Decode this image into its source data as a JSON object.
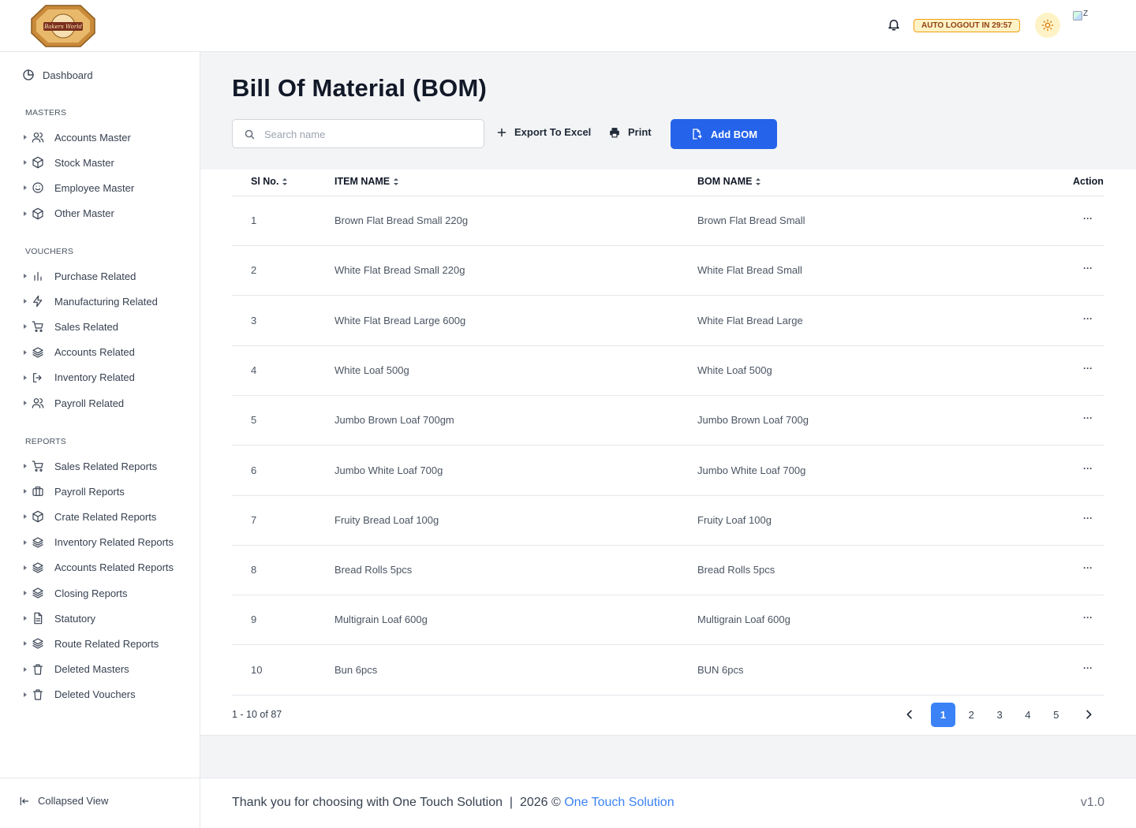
{
  "header": {
    "logo_text": "Bakers World",
    "auto_logout": "AUTO LOGOUT IN 29:57",
    "avatar_alt": "Z"
  },
  "sidebar": {
    "dashboard": "Dashboard",
    "sections": [
      {
        "title": "MASTERS",
        "items": [
          {
            "label": "Accounts Master",
            "icon": "user-icon"
          },
          {
            "label": "Stock Master",
            "icon": "cube-icon"
          },
          {
            "label": "Employee Master",
            "icon": "smile-icon"
          },
          {
            "label": "Other Master",
            "icon": "cube-icon"
          }
        ]
      },
      {
        "title": "VOUCHERS",
        "items": [
          {
            "label": "Purchase Related",
            "icon": "bar-chart-icon"
          },
          {
            "label": "Manufacturing Related",
            "icon": "bolt-icon"
          },
          {
            "label": "Sales Related",
            "icon": "cart-icon"
          },
          {
            "label": "Accounts Related",
            "icon": "layers-icon"
          },
          {
            "label": "Inventory Related",
            "icon": "logout-icon"
          },
          {
            "label": "Payroll Related",
            "icon": "user-icon"
          }
        ]
      },
      {
        "title": "REPORTS",
        "items": [
          {
            "label": "Sales Related Reports",
            "icon": "cart-icon"
          },
          {
            "label": "Payroll Reports",
            "icon": "briefcase-icon"
          },
          {
            "label": "Crate Related Reports",
            "icon": "cube-icon"
          },
          {
            "label": "Inventory Related Reports",
            "icon": "layers-icon"
          },
          {
            "label": "Accounts Related Reports",
            "icon": "layers-icon"
          },
          {
            "label": "Closing Reports",
            "icon": "layers-icon"
          },
          {
            "label": "Statutory",
            "icon": "document-icon"
          },
          {
            "label": "Route Related Reports",
            "icon": "layers-icon"
          },
          {
            "label": "Deleted Masters",
            "icon": "trash-icon"
          },
          {
            "label": "Deleted Vouchers",
            "icon": "trash-icon"
          }
        ]
      }
    ],
    "collapse_label": "Collapsed View"
  },
  "page": {
    "title": "Bill Of Material (BOM)",
    "search_placeholder": "Search name",
    "export_label": "Export To Excel",
    "print_label": "Print",
    "add_label": "Add BOM"
  },
  "table": {
    "headers": {
      "sl": "Sl No.",
      "item": "ITEM NAME",
      "bom": "BOM NAME",
      "action": "Action"
    },
    "rows": [
      {
        "sl": "1",
        "item": "Brown Flat Bread Small 220g",
        "bom": "Brown Flat Bread Small"
      },
      {
        "sl": "2",
        "item": "White Flat Bread Small 220g",
        "bom": "White Flat Bread Small"
      },
      {
        "sl": "3",
        "item": "White Flat Bread Large 600g",
        "bom": "White Flat Bread Large"
      },
      {
        "sl": "4",
        "item": "White Loaf 500g",
        "bom": "White Loaf 500g"
      },
      {
        "sl": "5",
        "item": "Jumbo Brown Loaf 700gm",
        "bom": "Jumbo Brown Loaf 700g"
      },
      {
        "sl": "6",
        "item": "Jumbo White Loaf 700g",
        "bom": "Jumbo White Loaf 700g"
      },
      {
        "sl": "7",
        "item": "Fruity Bread Loaf 100g",
        "bom": "Fruity Loaf 100g"
      },
      {
        "sl": "8",
        "item": "Bread Rolls 5pcs",
        "bom": "Bread Rolls 5pcs"
      },
      {
        "sl": "9",
        "item": "Multigrain Loaf 600g",
        "bom": "Multigrain Loaf 600g"
      },
      {
        "sl": "10",
        "item": "Bun 6pcs",
        "bom": "BUN 6pcs"
      }
    ],
    "action_glyph": "···"
  },
  "pagination": {
    "range": "1 - 10 of 87",
    "pages": [
      "1",
      "2",
      "3",
      "4",
      "5"
    ],
    "active": "1"
  },
  "footer": {
    "text": "Thank you for choosing with One Touch Solution  |  2026 © ",
    "link": "One Touch Solution",
    "version": "v1.0"
  },
  "colors": {
    "primary": "#2563eb",
    "active_page": "#3b82f6",
    "logout_badge_bg": "#fef3c7",
    "logout_badge_border": "#f59e0b"
  }
}
